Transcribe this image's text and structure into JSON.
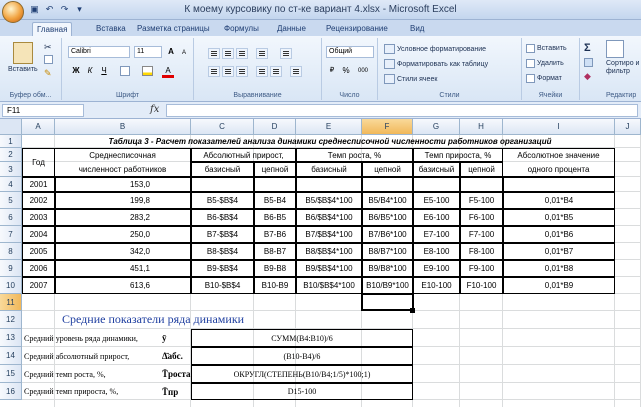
{
  "window": {
    "title": "К моему курсовику по ст-ке вариант 4.xlsx - Microsoft Excel"
  },
  "qat": [
    "save-icon",
    "undo-icon",
    "redo-icon",
    "dropdown-icon"
  ],
  "tabs": [
    "Главная",
    "Вставка",
    "Разметка страницы",
    "Формулы",
    "Данные",
    "Рецензирование",
    "Вид"
  ],
  "ribbon": {
    "clipboard": {
      "label": "Буфер обм...",
      "paste": "Вставить"
    },
    "font": {
      "label": "Шрифт",
      "name": "Calibri",
      "size": "11",
      "bold": "Ж",
      "italic": "К",
      "underline": "Ч",
      "grow": "A",
      "shrink": "A",
      "fontcolor": "A"
    },
    "alignment": {
      "label": "Выравнивание"
    },
    "number": {
      "label": "Число",
      "format": "Общий",
      "percent": "%",
      "thousands": "000"
    },
    "styles": {
      "label": "Стили",
      "conditional": "Условное форматирование",
      "astable": "Форматировать как таблицу",
      "cellstyles": "Стили ячеек"
    },
    "cells": {
      "label": "Ячейки",
      "insert": "Вставить",
      "delete": "Удалить",
      "format": "Формат"
    },
    "editing": {
      "label": "Редактир",
      "sigma": "Σ",
      "sort": "Сортиро и фильтр"
    }
  },
  "formula_bar": {
    "namebox": "F11",
    "fx": "fx",
    "value": ""
  },
  "columns": [
    "A",
    "B",
    "C",
    "D",
    "E",
    "F",
    "G",
    "H",
    "I",
    "J"
  ],
  "rows": [
    "1",
    "2",
    "3",
    "4",
    "5",
    "6",
    "7",
    "8",
    "9",
    "10",
    "11",
    "12",
    "13",
    "14",
    "15",
    "16"
  ],
  "sheet": {
    "title": "Таблица 3 - Расчет показателей анализа динамики среднесписочной численности работников организаций",
    "hdr": {
      "year": "Год",
      "avg1": "Среднесписочная",
      "avg2": "численност работников",
      "abs": "Абсолютный прирост,",
      "rate": "Темп роста, %",
      "growth": "Темп прироста, %",
      "absval1": "Абсолютное значение",
      "absval2": "одного процента",
      "basic": "базисный",
      "chain": "цепной"
    },
    "data": [
      {
        "year": "2001",
        "val": "153,0",
        "c": "",
        "d": "",
        "e": "",
        "f": "",
        "g": "",
        "h": "",
        "i": ""
      },
      {
        "year": "2002",
        "val": "199,8",
        "c": "B5-$B$4",
        "d": "B5-B4",
        "e": "B5/$B$4*100",
        "f": "B5/B4*100",
        "g": "E5-100",
        "h": "F5-100",
        "i": "0,01*B4"
      },
      {
        "year": "2003",
        "val": "283,2",
        "c": "B6-$B$4",
        "d": "B6-B5",
        "e": "B6/$B$4*100",
        "f": "B6/B5*100",
        "g": "E6-100",
        "h": "F6-100",
        "i": "0,01*B5"
      },
      {
        "year": "2004",
        "val": "250,0",
        "c": "B7-$B$4",
        "d": "B7-B6",
        "e": "B7/$B$4*100",
        "f": "B7/B6*100",
        "g": "E7-100",
        "h": "F7-100",
        "i": "0,01*B6"
      },
      {
        "year": "2005",
        "val": "342,0",
        "c": "B8-$B$4",
        "d": "B8-B7",
        "e": "B8/$B$4*100",
        "f": "B8/B7*100",
        "g": "E8-100",
        "h": "F8-100",
        "i": "0,01*B7"
      },
      {
        "year": "2006",
        "val": "451,1",
        "c": "B9-$B$4",
        "d": "B9-B8",
        "e": "B9/$B$4*100",
        "f": "B9/B8*100",
        "g": "E9-100",
        "h": "F9-100",
        "i": "0,01*B8"
      },
      {
        "year": "2007",
        "val": "613,6",
        "c": "B10-$B$4",
        "d": "B10-B9",
        "e": "B10/$B$4*100",
        "f": "B10/B9*100",
        "g": "E10-100",
        "h": "F10-100",
        "i": "0,01*B9"
      }
    ],
    "subtitle": "Средние показатели ряда динамики",
    "stats": [
      {
        "label": "Средний уровень ряда динамики,",
        "sym": "ȳ",
        "formula": "СУММ(B4:B10)/6"
      },
      {
        "label": "Средний абсолютный прирост,",
        "sym": "Δ̄абс.",
        "formula": "(B10-B4)/6"
      },
      {
        "label": "Средний темп роста, %,",
        "sym": "T̄роста",
        "formula": "ОКРУГЛ(СТЕПЕНЬ(B10/B4;1/5)*100;1)"
      },
      {
        "label": "Средний темп прироста, %,",
        "sym": "T̄пр",
        "formula": "D15-100"
      }
    ]
  }
}
